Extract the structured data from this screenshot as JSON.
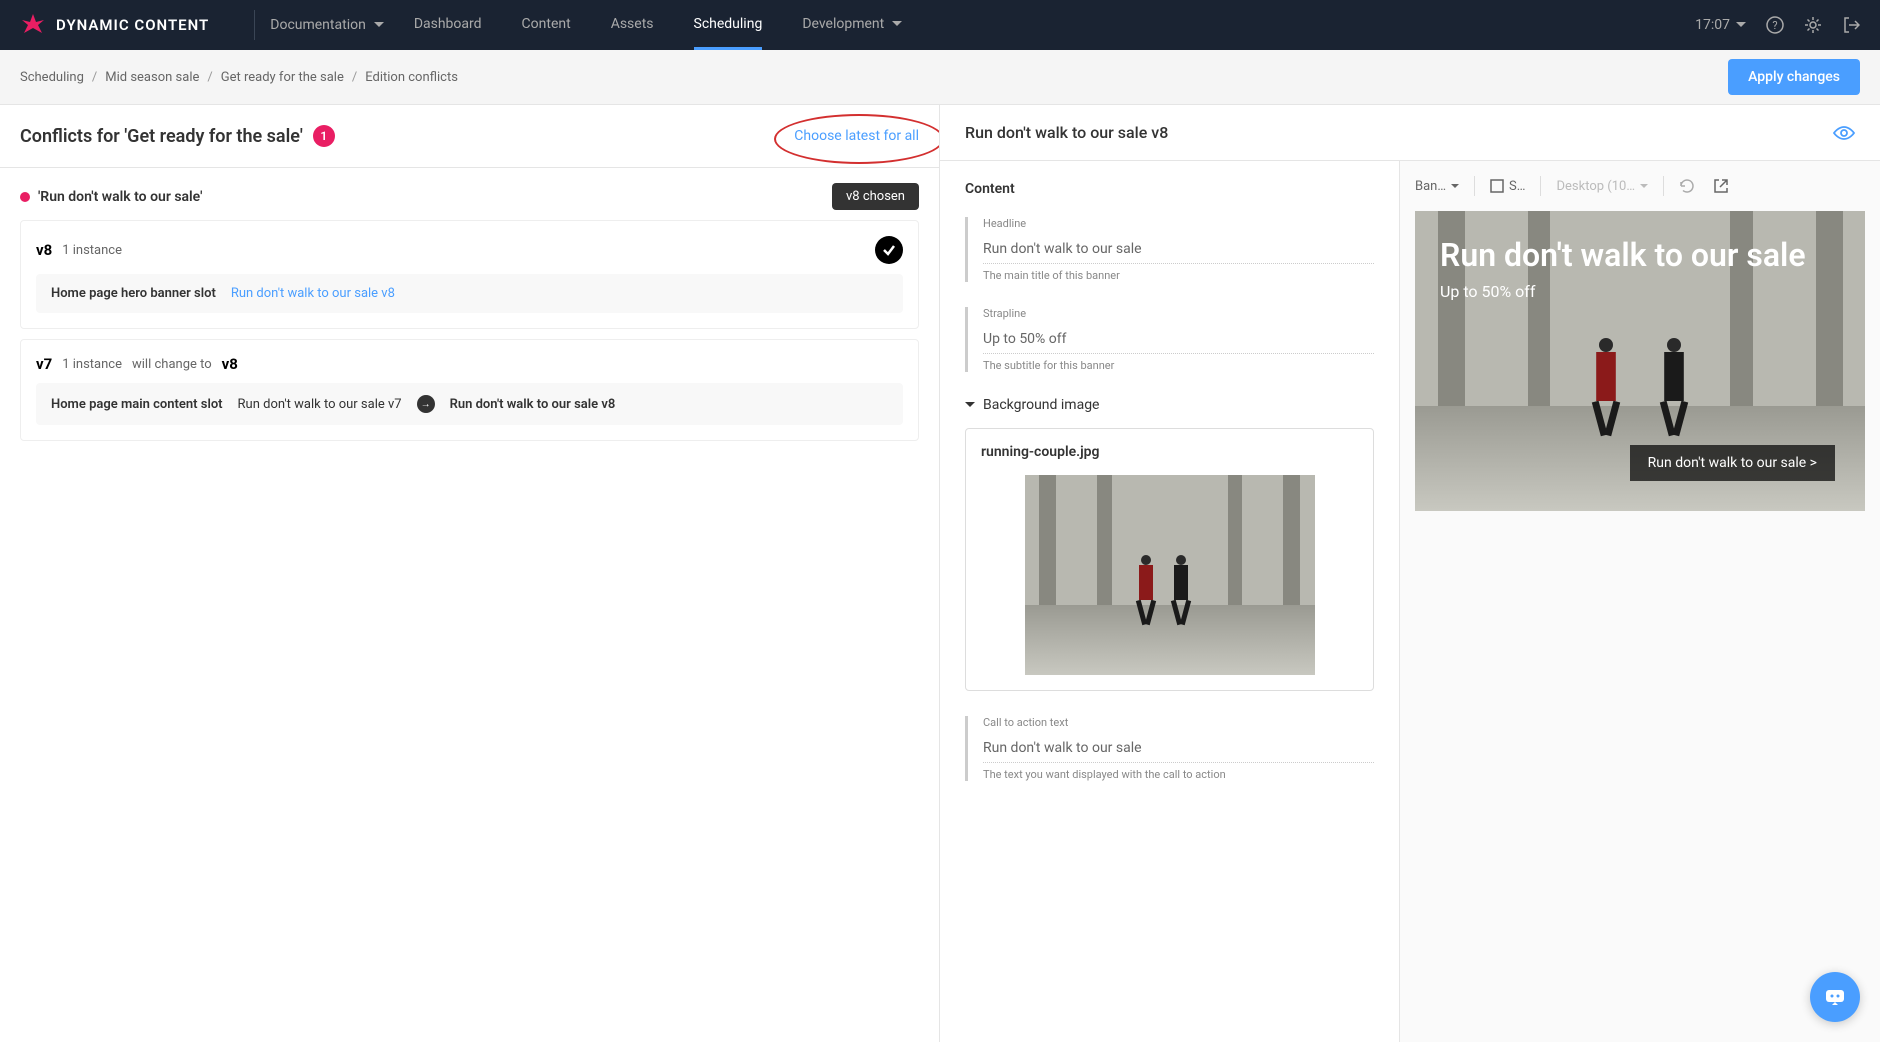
{
  "app": {
    "name": "DYNAMIC CONTENT"
  },
  "nav": {
    "dropdown": "Documentation",
    "items": [
      "Dashboard",
      "Content",
      "Assets",
      "Scheduling",
      "Development"
    ],
    "active_index": 3,
    "time": "17:07"
  },
  "breadcrumb": {
    "items": [
      "Scheduling",
      "Mid season sale",
      "Get ready for the sale",
      "Edition conflicts"
    ]
  },
  "actions": {
    "apply": "Apply changes"
  },
  "conflicts": {
    "title": "Conflicts for 'Get ready for the sale'",
    "count": "1",
    "choose_latest": "Choose latest for all",
    "item": {
      "name": "'Run don't walk to our sale'",
      "chosen_chip": "v8 chosen",
      "v8": {
        "label": "v8",
        "instances": "1 instance",
        "slot": "Home page hero banner slot",
        "link": "Run don't walk to our sale v8"
      },
      "v7": {
        "label": "v7",
        "instances": "1 instance",
        "change": "will change to",
        "change_to": "v8",
        "slot": "Home page main content slot",
        "from": "Run don't walk to our sale v7",
        "to": "Run don't walk to our sale v8"
      }
    }
  },
  "content": {
    "title": "Run don't walk to our sale v8",
    "section": "Content",
    "headline": {
      "label": "Headline",
      "value": "Run don't walk to our sale",
      "help": "The main title of this banner"
    },
    "strapline": {
      "label": "Strapline",
      "value": "Up to 50% off",
      "help": "The subtitle for this banner"
    },
    "bg_section": "Background image",
    "image_name": "running-couple.jpg",
    "cta": {
      "label": "Call to action text",
      "value": "Run don't walk to our sale",
      "help": "The text you want displayed with the call to action"
    }
  },
  "preview": {
    "type": "Ban…",
    "mode": "S…",
    "device": "Desktop (10…",
    "headline": "Run don't walk to our sale",
    "strapline": "Up to 50% off",
    "cta": "Run don't walk to our sale >"
  }
}
